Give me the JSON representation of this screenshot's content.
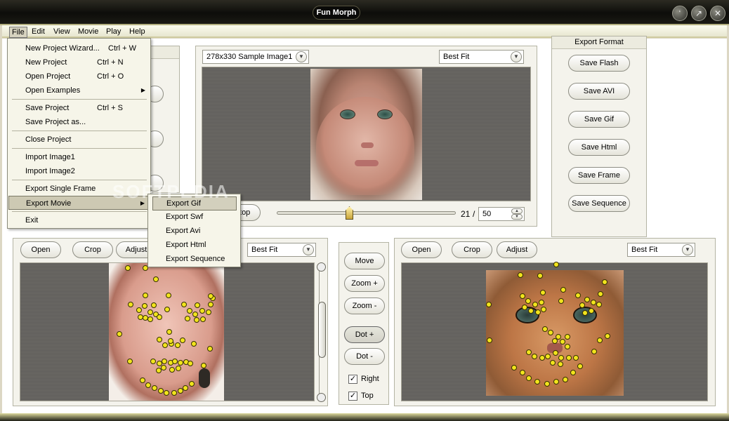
{
  "window": {
    "title": "Fun Morph"
  },
  "menubar": [
    "File",
    "Edit",
    "View",
    "Movie",
    "Play",
    "Help"
  ],
  "file_menu": [
    {
      "label": "New Project Wizard...",
      "shortcut": "Ctrl + W"
    },
    {
      "label": "New Project",
      "shortcut": "Ctrl + N"
    },
    {
      "label": "Open Project",
      "shortcut": "Ctrl + O"
    },
    {
      "label": "Open Examples",
      "submenu": true
    },
    {
      "label": "Save Project",
      "shortcut": "Ctrl + S"
    },
    {
      "label": "Save Project as...",
      "shortcut": ""
    },
    {
      "label": "Close Project"
    },
    {
      "label": "Import Image1"
    },
    {
      "label": "Import Image2"
    },
    {
      "label": "Export Single Frame"
    },
    {
      "label": "Export Movie",
      "submenu": true
    },
    {
      "label": "Exit"
    }
  ],
  "export_movie_submenu": [
    "Export Gif",
    "Export Swf",
    "Export Avi",
    "Export Html",
    "Export Sequence"
  ],
  "preview": {
    "image_select": "278x330 Sample Image1",
    "fit_select": "Best Fit",
    "stop_label": "Stop",
    "frame": "21",
    "frame_sep": "/",
    "total_frames": "50",
    "slider_fraction": 0.41
  },
  "export_format": {
    "title": "Export Format",
    "buttons": [
      "Save Flash",
      "Save AVI",
      "Save Gif",
      "Save Html",
      "Save Frame",
      "Save Sequence"
    ]
  },
  "left_editor": {
    "open": "Open",
    "crop": "Crop",
    "adjust": "Adjust",
    "fit_select": "Best Fit"
  },
  "right_editor": {
    "open": "Open",
    "crop": "Crop",
    "adjust": "Adjust",
    "fit_select": "Best Fit"
  },
  "tools": {
    "move": "Move",
    "zoom_in": "Zoom +",
    "zoom_out": "Zoom -",
    "dot_add": "Dot +",
    "dot_remove": "Dot -",
    "right_label": "Right",
    "top_label": "Top",
    "right_checked": true,
    "top_checked": true
  },
  "watermark": "SOFTPEDIA"
}
